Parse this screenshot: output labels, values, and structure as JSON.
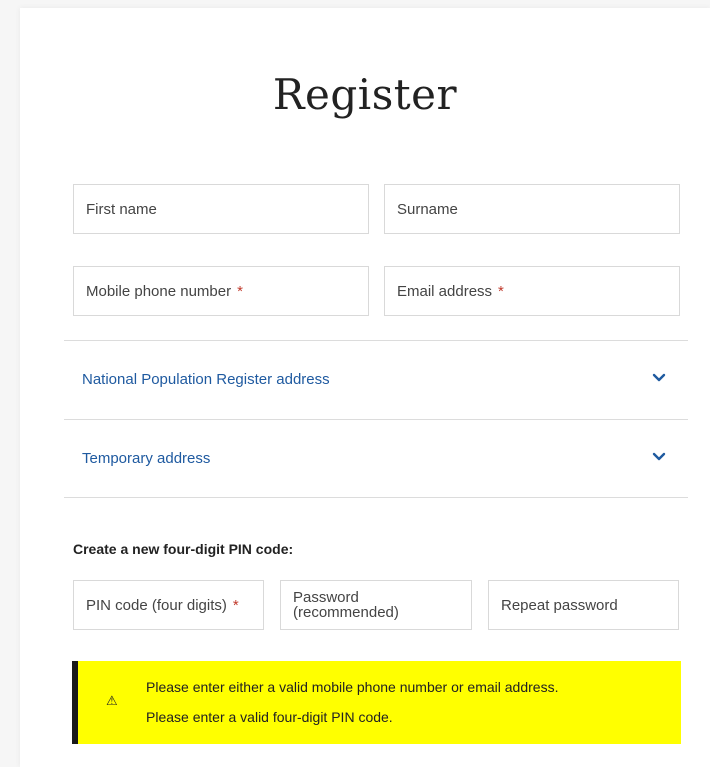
{
  "page": {
    "title": "Register"
  },
  "form": {
    "first_name": {
      "placeholder": "First name"
    },
    "surname": {
      "placeholder": "Surname"
    },
    "mobile": {
      "placeholder": "Mobile phone number",
      "required_mark": "*"
    },
    "email": {
      "placeholder": "Email address",
      "required_mark": "*"
    }
  },
  "sections": [
    {
      "label": "National Population Register address",
      "icon": "chevron-down-icon"
    },
    {
      "label": "Temporary address",
      "icon": "chevron-down-icon"
    }
  ],
  "pin": {
    "heading": "Create a new four-digit PIN code:",
    "pin_code": {
      "placeholder": "PIN code (four digits)",
      "required_mark": "*"
    },
    "password": {
      "placeholder_line1": "Password",
      "placeholder_line2": "(recommended)"
    },
    "repeat_password": {
      "placeholder": "Repeat password"
    }
  },
  "alert": {
    "icon": "warning-icon",
    "glyph": "⚠",
    "messages": [
      "Please enter either a valid mobile phone number or email address.",
      "Please enter a valid four-digit PIN code."
    ]
  },
  "colors": {
    "link": "#1f5aa0",
    "required": "#c0392b",
    "alert_bg": "#ffff00",
    "alert_border": "#1a1a1a"
  }
}
